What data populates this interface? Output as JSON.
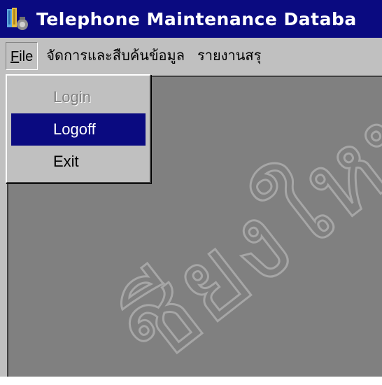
{
  "window": {
    "title": "Telephone Maintenance Databa",
    "icon": "app-icon"
  },
  "menubar": {
    "items": [
      {
        "label": "File",
        "mnemonic": "F"
      },
      {
        "label": "จัดการและสืบค้นข้อมูล"
      },
      {
        "label": "รายงานสรุ"
      }
    ]
  },
  "file_menu": {
    "items": [
      {
        "label": "Login",
        "state": "disabled"
      },
      {
        "label": "Logoff",
        "state": "highlighted"
      },
      {
        "label": "Exit",
        "state": "normal"
      }
    ]
  },
  "watermark": {
    "text": "ชียงใหม่"
  },
  "colors": {
    "titlebar": "#0a0a80",
    "menu_highlight": "#0a0a80",
    "client_background": "#808080",
    "chrome": "#c0c0c0"
  }
}
